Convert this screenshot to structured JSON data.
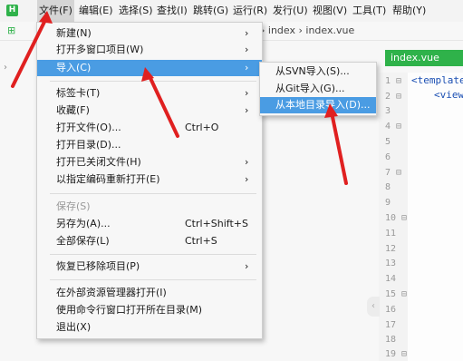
{
  "menubar": {
    "logo": "H",
    "items": [
      "文件(F)",
      "编辑(E)",
      "选择(S)",
      "查找(I)",
      "跳转(G)",
      "运行(R)",
      "发行(U)",
      "视图(V)",
      "工具(T)",
      "帮助(Y)"
    ]
  },
  "breadcrumb": "› index › index.vue",
  "editor": {
    "tab_label": "index.vue",
    "line_numbers": [
      "1 ⊟",
      "2 ⊟",
      "3",
      "4 ⊟",
      "5",
      "6",
      "7 ⊟",
      "8",
      "9",
      "10 ⊟",
      "11",
      "12",
      "13",
      "14",
      "15 ⊟",
      "16",
      "17",
      "18",
      "19 ⊟"
    ],
    "code_lines": [
      "<template",
      "<view"
    ]
  },
  "file_menu": {
    "items": [
      {
        "label": "新建(N)",
        "shortcut": "",
        "arrow": "›",
        "disabled": false
      },
      {
        "label": "打开多窗口项目(W)",
        "shortcut": "",
        "arrow": "›",
        "disabled": false
      },
      {
        "label": "导入(C)",
        "shortcut": "",
        "arrow": "›",
        "disabled": false
      },
      {
        "label": "标签卡(T)",
        "shortcut": "",
        "arrow": "›",
        "disabled": false
      },
      {
        "label": "收藏(F)",
        "shortcut": "",
        "arrow": "›",
        "disabled": false
      },
      {
        "label": "打开文件(O)...",
        "shortcut": "Ctrl+O",
        "arrow": "",
        "disabled": false
      },
      {
        "label": "打开目录(D)...",
        "shortcut": "",
        "arrow": "",
        "disabled": false
      },
      {
        "label": "打开已关闭文件(H)",
        "shortcut": "",
        "arrow": "›",
        "disabled": false
      },
      {
        "label": "以指定编码重新打开(E)",
        "shortcut": "",
        "arrow": "›",
        "disabled": false
      },
      {
        "label": "保存(S)",
        "shortcut": "",
        "arrow": "",
        "disabled": true
      },
      {
        "label": "另存为(A)...",
        "shortcut": "Ctrl+Shift+S",
        "arrow": "",
        "disabled": false
      },
      {
        "label": "全部保存(L)",
        "shortcut": "Ctrl+S",
        "arrow": "",
        "disabled": false
      },
      {
        "label": "恢复已移除项目(P)",
        "shortcut": "",
        "arrow": "›",
        "disabled": false
      },
      {
        "label": "在外部资源管理器打开(I)",
        "shortcut": "",
        "arrow": "",
        "disabled": false
      },
      {
        "label": "使用命令行窗口打开所在目录(M)",
        "shortcut": "",
        "arrow": "",
        "disabled": false
      },
      {
        "label": "退出(X)",
        "shortcut": "",
        "arrow": "",
        "disabled": false
      }
    ]
  },
  "import_submenu": {
    "items": [
      "从SVN导入(S)...",
      "从Git导入(G)...",
      "从本地目录导入(D)..."
    ]
  },
  "colors": {
    "highlight": "#4a9ce3",
    "brand_green": "#2fb24a",
    "annotation_arrow": "#e02020"
  }
}
